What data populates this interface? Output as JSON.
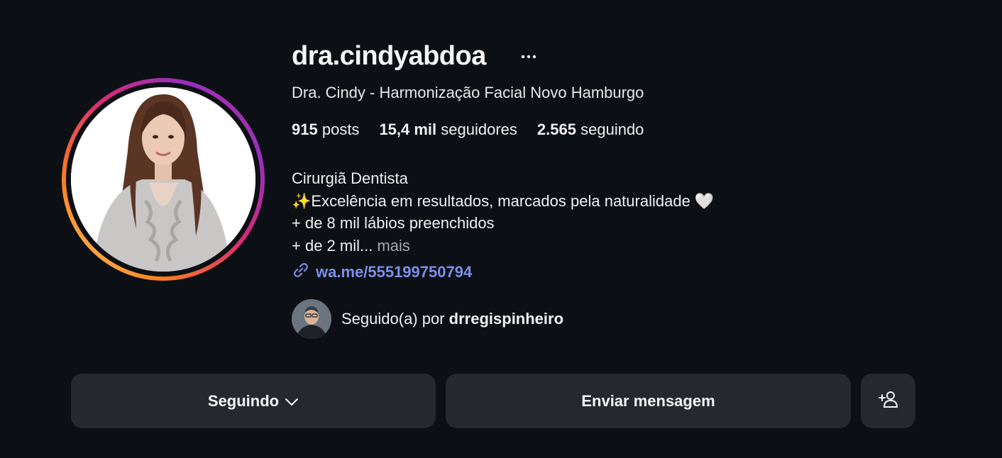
{
  "profile": {
    "username": "dra.cindyabdoa",
    "full_name": "Dra. Cindy - Harmonização Facial Novo Hamburgo",
    "more_icon": "ellipsis-icon"
  },
  "stats": {
    "posts_count": "915",
    "posts_label": "posts",
    "followers_count": "15,4 mil",
    "followers_label": "seguidores",
    "following_count": "2.565",
    "following_label": "seguindo"
  },
  "bio": {
    "line1": "Cirurgiã Dentista",
    "line2": "✨Excelência em resultados, marcados pela naturalidade 🤍",
    "line3": "+ de 8 mil lábios preenchidos",
    "line4": "+ de 2 mil...",
    "more_label": "mais"
  },
  "link": {
    "icon": "link-icon",
    "text": "wa.me/555199750794",
    "color": "#7c8fe8"
  },
  "followed_by": {
    "prefix": "Seguido(a) por",
    "username": "drregispinheiro"
  },
  "actions": {
    "following_label": "Seguindo",
    "message_label": "Enviar mensagem",
    "add_user_icon": "add-person-icon"
  },
  "colors": {
    "background": "#0c0f14",
    "button": "#25292e",
    "link": "#7c8fe8",
    "muted": "#a8a8a8"
  }
}
